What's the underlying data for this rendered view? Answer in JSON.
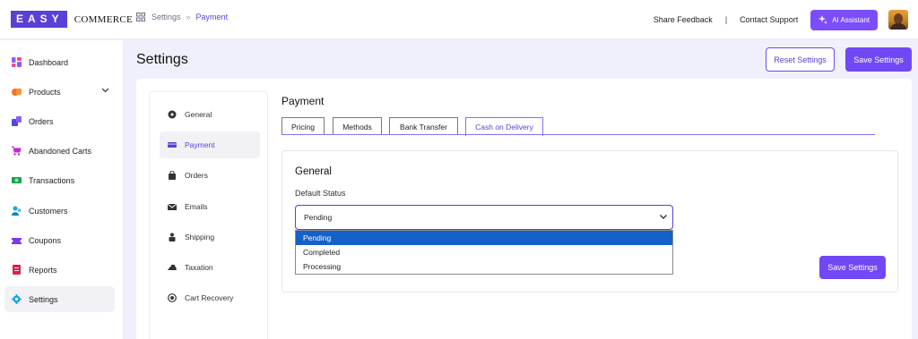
{
  "brand": {
    "logo_box": "EASY",
    "logo_word": "COMMERCE",
    "color": "#5b3fd6"
  },
  "breadcrumb": {
    "parent": "Settings",
    "separator": "»",
    "current": "Payment"
  },
  "topnav": {
    "share_feedback": "Share Feedback",
    "divider": "|",
    "contact_support": "Contact Support",
    "ai_assistant": "AI Assistant"
  },
  "sidebar": {
    "items": [
      {
        "label": "Dashboard",
        "icon": "dashboard-icon"
      },
      {
        "label": "Products",
        "icon": "products-icon"
      },
      {
        "label": "Orders",
        "icon": "orders-icon"
      },
      {
        "label": "Abandoned Carts",
        "icon": "cart-icon"
      },
      {
        "label": "Transactions",
        "icon": "transactions-icon"
      },
      {
        "label": "Customers",
        "icon": "customers-icon"
      },
      {
        "label": "Coupons",
        "icon": "coupons-icon"
      },
      {
        "label": "Reports",
        "icon": "reports-icon"
      },
      {
        "label": "Settings",
        "icon": "gear-icon",
        "active": true
      }
    ]
  },
  "header": {
    "title": "Settings",
    "reset_label": "Reset Settings",
    "save_label": "Save Settings"
  },
  "settings_nav": {
    "items": [
      {
        "label": "General",
        "icon": "general-icon"
      },
      {
        "label": "Payment",
        "icon": "payment-icon",
        "active": true
      },
      {
        "label": "Orders",
        "icon": "orders-bag-icon"
      },
      {
        "label": "Emails",
        "icon": "email-icon"
      },
      {
        "label": "Shipping",
        "icon": "shipping-icon"
      },
      {
        "label": "Taxation",
        "icon": "taxation-icon"
      },
      {
        "label": "Cart Recovery",
        "icon": "cart-recovery-icon"
      }
    ]
  },
  "payment": {
    "title": "Payment",
    "tabs": [
      "Pricing",
      "Methods",
      "Bank Transfer",
      "Cash on Delivery"
    ],
    "active_tab": "Cash on Delivery",
    "section_title": "General",
    "default_status_label": "Default Status",
    "default_status_value": "Pending",
    "options": [
      "Pending",
      "Completed",
      "Processing"
    ],
    "highlighted_option": "Pending",
    "save_label": "Save Settings"
  },
  "colors": {
    "accent": "#7148f5",
    "dropdown_highlight": "#1660c9",
    "background": "#f0f0fc"
  }
}
